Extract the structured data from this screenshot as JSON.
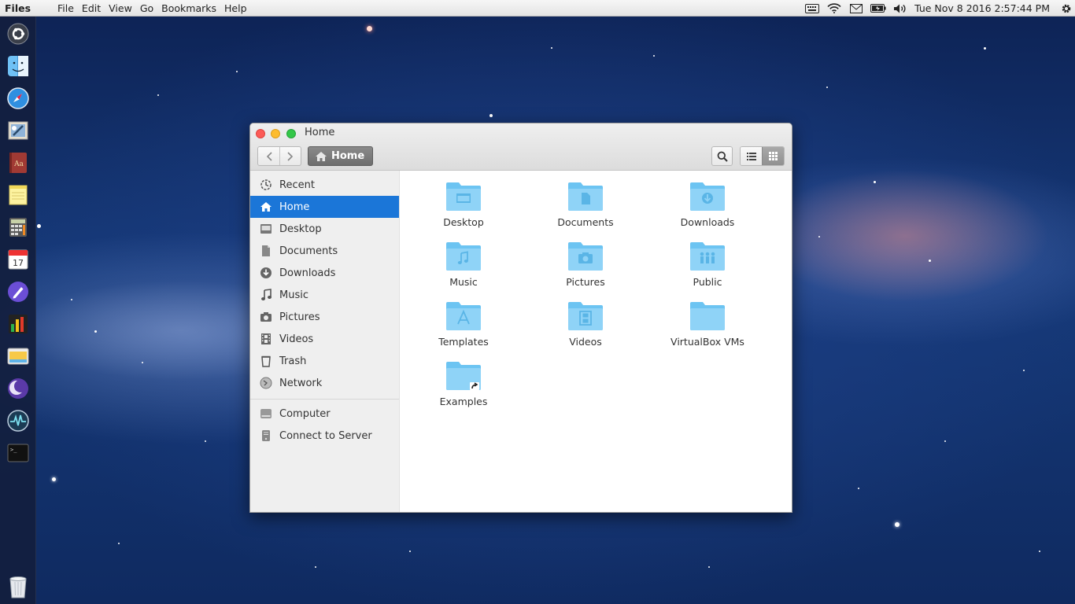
{
  "menubar": {
    "app_name": "Files",
    "menus": [
      "File",
      "Edit",
      "View",
      "Go",
      "Bookmarks",
      "Help"
    ],
    "clock": "Tue Nov  8 2016  2:57:44 PM"
  },
  "dock": {
    "apps": [
      "ubuntu-logo",
      "finder",
      "safari",
      "mail",
      "dictionary",
      "notes",
      "calculator",
      "calendar",
      "pen",
      "activity-bars",
      "files",
      "moon",
      "system-monitor",
      "terminal"
    ],
    "calendar_day": "17",
    "trash": "trash"
  },
  "window": {
    "title": "Home",
    "path_button": "Home",
    "sidebar": {
      "places": [
        "Recent",
        "Home",
        "Desktop",
        "Documents",
        "Downloads",
        "Music",
        "Pictures",
        "Videos",
        "Trash",
        "Network"
      ],
      "devices": [
        "Computer",
        "Connect to Server"
      ],
      "active": "Home"
    },
    "files": [
      "Desktop",
      "Documents",
      "Downloads",
      "Music",
      "Pictures",
      "Public",
      "Templates",
      "Videos",
      "VirtualBox VMs",
      "Examples"
    ]
  },
  "colors": {
    "selection": "#1b76d8",
    "folder": "#6cc4f2"
  }
}
